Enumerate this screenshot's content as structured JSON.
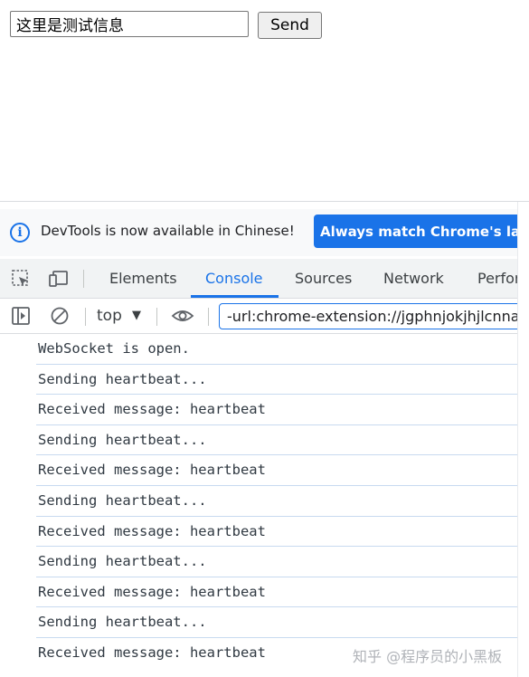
{
  "page": {
    "input_value": "这里是测试信息",
    "send_label": "Send"
  },
  "devtools": {
    "notice": {
      "text": "DevTools is now available in Chinese!",
      "button_label": "Always match Chrome's language"
    },
    "tabs": [
      {
        "label": "Elements"
      },
      {
        "label": "Console",
        "active": true
      },
      {
        "label": "Sources"
      },
      {
        "label": "Network"
      },
      {
        "label": "Performance"
      }
    ],
    "toolbar": {
      "context": "top",
      "filter_value": "-url:chrome-extension://jgphnjokjhjlcnnajmfjlacjbjdfklpm"
    },
    "console_lines": [
      "WebSocket is open.",
      "Sending heartbeat...",
      "Received message: heartbeat",
      "Sending heartbeat...",
      "Received message: heartbeat",
      "Sending heartbeat...",
      "Received message: heartbeat",
      "Sending heartbeat...",
      "Received message: heartbeat",
      "Sending heartbeat...",
      "Received message: heartbeat"
    ],
    "accent": "#1a73e8"
  },
  "watermark": "知乎 @程序员的小黑板"
}
